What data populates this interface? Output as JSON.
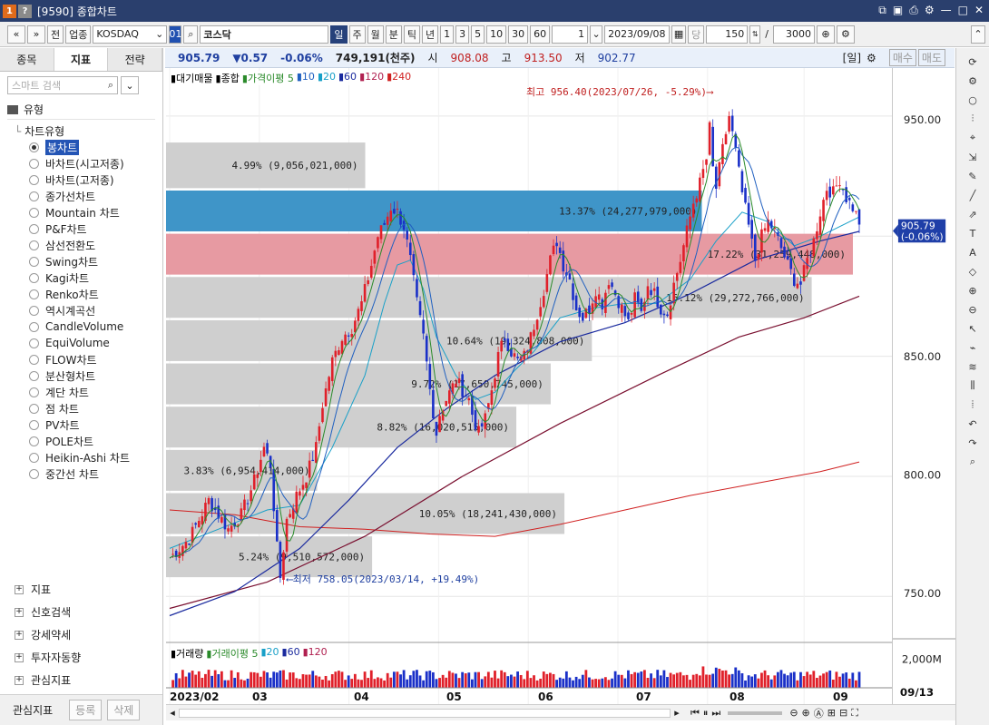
{
  "window": {
    "badge_1": "1",
    "badge_2": "?",
    "title": "[9590] 종합차트"
  },
  "toolbar": {
    "back": "«",
    "down": "»",
    "prev_btn": "전",
    "sector_btn": "업종",
    "market": "KOSDAQ",
    "code": "01",
    "name": "코스닥",
    "periods": [
      "일",
      "주",
      "월",
      "분",
      "틱",
      "년"
    ],
    "period_selected": "일",
    "intervals": [
      "1",
      "3",
      "5",
      "10",
      "30",
      "60"
    ],
    "count_box": "1",
    "date": "2023/09/08",
    "unit_label": "당",
    "bars": "150",
    "slash": "/",
    "max_bars": "3000"
  },
  "left_panel": {
    "tabs": [
      "종목",
      "지표",
      "전략"
    ],
    "active_tab": "지표",
    "search_placeholder": "스마트 검색",
    "type_header": "유형",
    "category": "차트유형",
    "chart_types": [
      "봉차트",
      "바차트(시고저종)",
      "바차트(고저종)",
      "종가선차트",
      "Mountain 차트",
      "P&F차트",
      "삼선전환도",
      "Swing차트",
      "Kagi차트",
      "Renko차트",
      "역시계곡선",
      "CandleVolume",
      "EquiVolume",
      "FLOW차트",
      "분산형차트",
      "계단 차트",
      "점 차트",
      "PV차트",
      "POLE차트",
      "Heikin-Ashi 차트",
      "중간선 차트"
    ],
    "selected_type": "봉차트",
    "groups": [
      "지표",
      "신호검색",
      "강세약세",
      "투자자동향",
      "관심지표"
    ],
    "bottom": {
      "label": "관심지표",
      "register": "등록",
      "delete": "삭제"
    }
  },
  "infobar": {
    "price": "905.79",
    "change": "▼0.57",
    "pct": "-0.06%",
    "volume": "749,191(천주)",
    "open_label": "시",
    "open": "908.08",
    "high_label": "고",
    "high": "913.50",
    "low_label": "저",
    "low": "902.77",
    "right_label": "[일]",
    "buy": "매수",
    "sell": "매도"
  },
  "legend": {
    "items": [
      "대기매물",
      "종합",
      "가격이평 5",
      "10",
      "20",
      "60",
      "120",
      "240"
    ],
    "colors": [
      "#000000",
      "#000000",
      "#2a8a2a",
      "#2060c0",
      "#19a0c8",
      "#1a2a9e",
      "#b02050",
      "#d02020"
    ]
  },
  "annotations": {
    "high_text": "최고 956.40(2023/07/26, -5.29%)⟶",
    "low_text": "⟵최저 758.05(2023/03/14, +19.49%)"
  },
  "volume_panel": {
    "legend": [
      "거래량",
      "거래이평 5",
      "20",
      "60",
      "120"
    ],
    "y_label": "2,000M"
  },
  "x_labels": [
    "2023/02",
    "03",
    "04",
    "05",
    "06",
    "07",
    "08",
    "09",
    "09/13"
  ],
  "chart_data": {
    "type": "candlestick",
    "x_range": [
      "2023/02",
      "2023/09"
    ],
    "ylim": [
      735,
      970
    ],
    "y_ticks": [
      950,
      900,
      850,
      800,
      750
    ],
    "y_tick_labels": [
      "950.00",
      "850.00",
      "800.00",
      "750.00"
    ],
    "current_price_label": "905.79",
    "current_change_label": "(-0.06%)",
    "volume_profile": [
      {
        "label": "4.99% (9,056,021,000)",
        "lo": 920,
        "hi": 939,
        "frac": 0.29
      },
      {
        "label": "13.37% (24,277,979,000)",
        "lo": 902,
        "hi": 919,
        "frac": 0.78,
        "highlight": "blue"
      },
      {
        "label": "17.22% (31,259,448,000)",
        "lo": 884,
        "hi": 901,
        "frac": 1.0,
        "highlight": "red"
      },
      {
        "label": "16.12% (29,272,766,000)",
        "lo": 866,
        "hi": 883,
        "frac": 0.94
      },
      {
        "label": "10.64% (19,324,808,000)",
        "lo": 848,
        "hi": 865,
        "frac": 0.62
      },
      {
        "label": "9.72% (17,650,745,000)",
        "lo": 830,
        "hi": 847,
        "frac": 0.56
      },
      {
        "label": "8.82% (16,020,515,000)",
        "lo": 812,
        "hi": 829,
        "frac": 0.51
      },
      {
        "label": "3.83% (6,954,414,000)",
        "lo": 794,
        "hi": 811,
        "frac": 0.22
      },
      {
        "label": "10.05% (18,241,430,000)",
        "lo": 776,
        "hi": 793,
        "frac": 0.58
      },
      {
        "label": "5.24% (9,510,572,000)",
        "lo": 758,
        "hi": 775,
        "frac": 0.3
      }
    ],
    "close_path": [
      [
        0,
        766
      ],
      [
        6,
        774
      ],
      [
        12,
        790
      ],
      [
        18,
        778
      ],
      [
        22,
        784
      ],
      [
        26,
        798
      ],
      [
        29,
        812
      ],
      [
        31,
        805
      ],
      [
        33,
        770
      ],
      [
        34,
        758
      ],
      [
        36,
        782
      ],
      [
        39,
        792
      ],
      [
        42,
        800
      ],
      [
        45,
        812
      ],
      [
        47,
        830
      ],
      [
        50,
        848
      ],
      [
        53,
        858
      ],
      [
        56,
        862
      ],
      [
        59,
        872
      ],
      [
        62,
        888
      ],
      [
        64,
        900
      ],
      [
        66,
        905
      ],
      [
        68,
        912
      ],
      [
        70,
        910
      ],
      [
        72,
        904
      ],
      [
        74,
        890
      ],
      [
        76,
        872
      ],
      [
        78,
        858
      ],
      [
        80,
        836
      ],
      [
        82,
        818
      ],
      [
        83,
        826
      ],
      [
        85,
        832
      ],
      [
        88,
        840
      ],
      [
        90,
        836
      ],
      [
        92,
        832
      ],
      [
        93,
        826
      ],
      [
        95,
        818
      ],
      [
        97,
        824
      ],
      [
        99,
        836
      ],
      [
        101,
        850
      ],
      [
        103,
        858
      ],
      [
        105,
        852
      ],
      [
        107,
        848
      ],
      [
        109,
        850
      ],
      [
        111,
        858
      ],
      [
        113,
        868
      ],
      [
        115,
        878
      ],
      [
        117,
        890
      ],
      [
        119,
        898
      ],
      [
        121,
        888
      ],
      [
        123,
        882
      ],
      [
        125,
        870
      ],
      [
        127,
        866
      ],
      [
        129,
        870
      ],
      [
        131,
        878
      ],
      [
        133,
        872
      ],
      [
        135,
        882
      ],
      [
        137,
        876
      ],
      [
        139,
        870
      ],
      [
        141,
        864
      ],
      [
        143,
        874
      ],
      [
        145,
        868
      ],
      [
        147,
        880
      ],
      [
        149,
        876
      ],
      [
        151,
        870
      ],
      [
        153,
        868
      ],
      [
        155,
        880
      ],
      [
        157,
        890
      ],
      [
        159,
        902
      ],
      [
        161,
        914
      ],
      [
        163,
        922
      ],
      [
        165,
        932
      ],
      [
        166,
        945
      ],
      [
        167,
        928
      ],
      [
        168,
        920
      ],
      [
        170,
        936
      ],
      [
        172,
        950
      ],
      [
        174,
        935
      ],
      [
        176,
        918
      ],
      [
        178,
        904
      ],
      [
        180,
        890
      ],
      [
        182,
        900
      ],
      [
        184,
        906
      ],
      [
        186,
        902
      ],
      [
        188,
        895
      ],
      [
        190,
        888
      ],
      [
        192,
        882
      ],
      [
        194,
        880
      ],
      [
        196,
        890
      ],
      [
        198,
        898
      ],
      [
        200,
        910
      ],
      [
        202,
        920
      ],
      [
        204,
        918
      ],
      [
        206,
        924
      ],
      [
        208,
        916
      ],
      [
        210,
        912
      ],
      [
        212,
        906
      ]
    ],
    "ma_20_path": [
      [
        0,
        770
      ],
      [
        15,
        778
      ],
      [
        30,
        786
      ],
      [
        40,
        788
      ],
      [
        50,
        812
      ],
      [
        60,
        842
      ],
      [
        66,
        872
      ],
      [
        70,
        888
      ],
      [
        74,
        890
      ],
      [
        78,
        878
      ],
      [
        82,
        858
      ],
      [
        88,
        842
      ],
      [
        94,
        832
      ],
      [
        100,
        835
      ],
      [
        106,
        844
      ],
      [
        112,
        852
      ],
      [
        120,
        866
      ],
      [
        130,
        870
      ],
      [
        140,
        872
      ],
      [
        150,
        872
      ],
      [
        160,
        882
      ],
      [
        168,
        898
      ],
      [
        176,
        910
      ],
      [
        184,
        906
      ],
      [
        192,
        896
      ],
      [
        200,
        900
      ],
      [
        212,
        908
      ]
    ],
    "ma_60_path": [
      [
        0,
        742
      ],
      [
        20,
        752
      ],
      [
        40,
        770
      ],
      [
        55,
        790
      ],
      [
        70,
        812
      ],
      [
        85,
        828
      ],
      [
        100,
        842
      ],
      [
        120,
        856
      ],
      [
        140,
        864
      ],
      [
        160,
        876
      ],
      [
        180,
        890
      ],
      [
        200,
        898
      ],
      [
        212,
        902
      ]
    ],
    "ma_120_path": [
      [
        0,
        745
      ],
      [
        30,
        756
      ],
      [
        60,
        775
      ],
      [
        90,
        800
      ],
      [
        120,
        822
      ],
      [
        150,
        842
      ],
      [
        175,
        858
      ],
      [
        195,
        866
      ],
      [
        212,
        875
      ]
    ],
    "ma_240_path": [
      [
        0,
        786
      ],
      [
        20,
        784
      ],
      [
        40,
        779
      ],
      [
        60,
        778
      ],
      [
        80,
        776
      ],
      [
        100,
        775
      ],
      [
        120,
        780
      ],
      [
        140,
        786
      ],
      [
        160,
        792
      ],
      [
        180,
        797
      ],
      [
        200,
        802
      ],
      [
        212,
        806
      ]
    ]
  }
}
